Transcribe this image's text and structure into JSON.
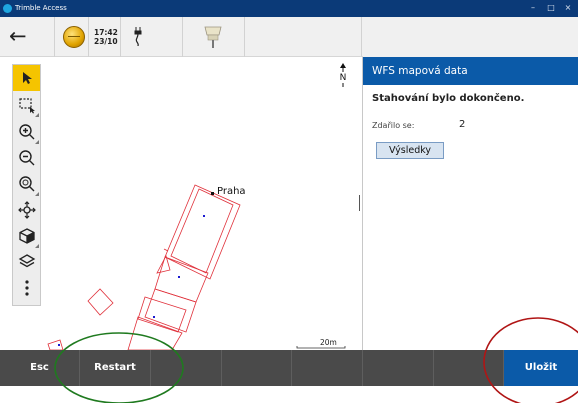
{
  "window": {
    "title": "Trimble Access",
    "controls": [
      "–",
      "□",
      "×"
    ]
  },
  "status_bar": {
    "back_icon": "back-arrow-icon",
    "time": "17:42",
    "date": "23/10"
  },
  "map": {
    "place_label": "Praha",
    "north_label": "N",
    "scale_label": "20m",
    "boundary_color": "#e0303a",
    "point_color": "#1a1ad0",
    "tools": [
      {
        "name": "select-arrow-icon",
        "active": true
      },
      {
        "name": "box-select-icon"
      },
      {
        "name": "zoom-in-icon"
      },
      {
        "name": "zoom-out-icon"
      },
      {
        "name": "zoom-extents-icon"
      },
      {
        "name": "pan-icon"
      },
      {
        "name": "3d-view-icon"
      },
      {
        "name": "layers-icon"
      },
      {
        "name": "more-menu-icon"
      }
    ]
  },
  "panel": {
    "title": "WFS mapová data",
    "message": "Stahování bylo dokončeno.",
    "success_label": "Zdařilo se:",
    "success_count": "2",
    "results_button": "Výsledky"
  },
  "softkeys": {
    "esc": "Esc",
    "restart": "Restart",
    "save": "Uložit"
  },
  "colors": {
    "accent": "#0b5aa8",
    "title_bar": "#0b3a78",
    "softkey_bar": "#4a4a4a",
    "active_tool": "#f5c400",
    "annotation_green": "#1f7a1f",
    "annotation_red": "#b01515"
  }
}
